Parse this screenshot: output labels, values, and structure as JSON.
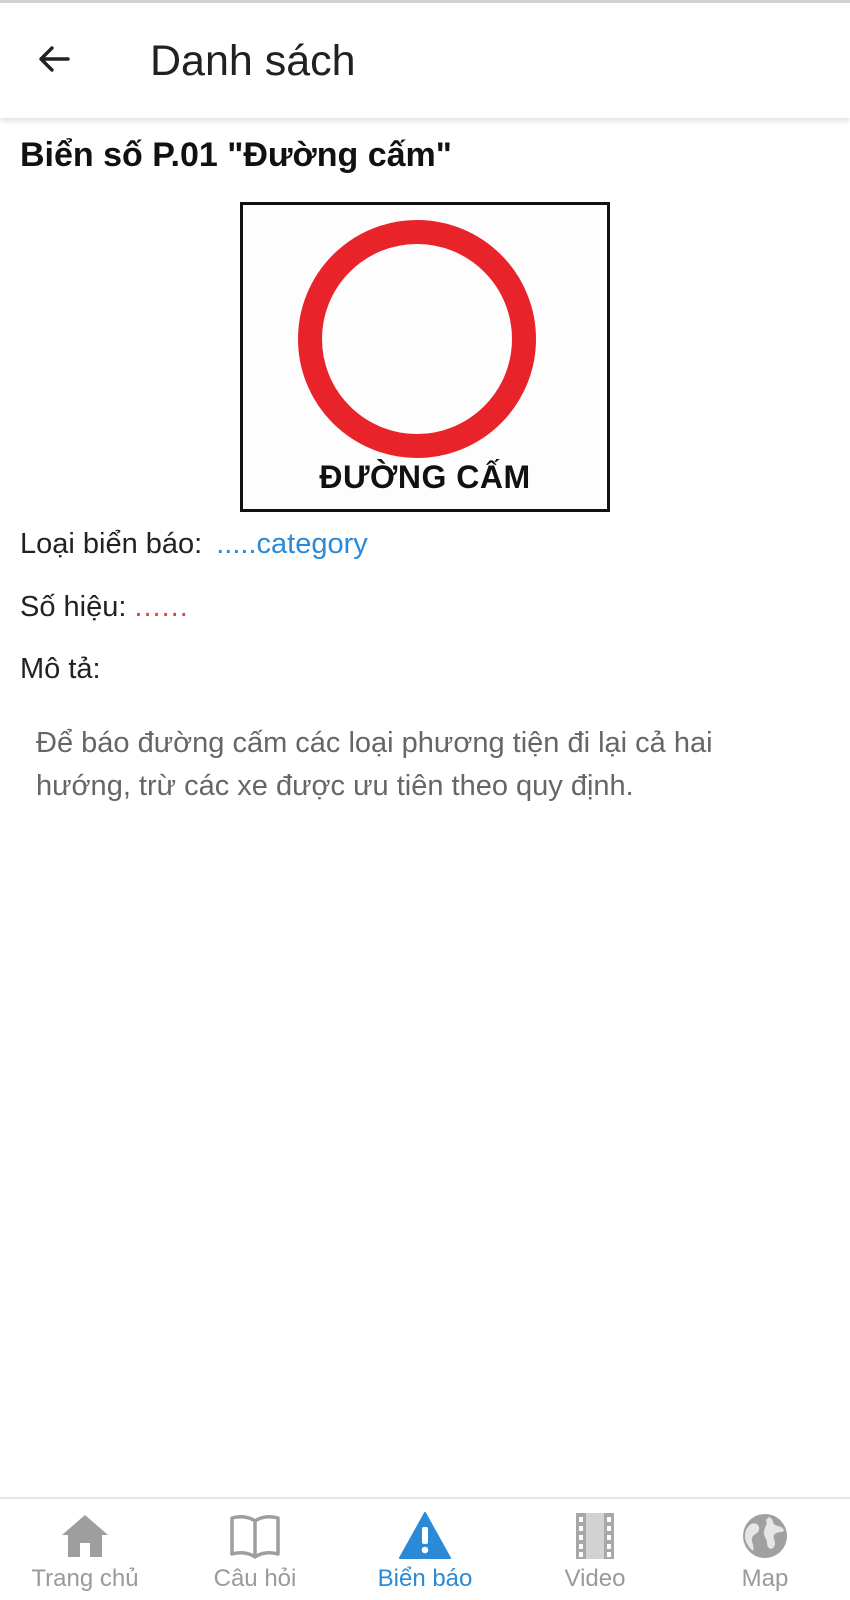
{
  "appbar": {
    "title": "Danh sách",
    "back_icon": "arrow-left-icon"
  },
  "sign": {
    "title": "Biển số P.01 \"Đường cấm\"",
    "image_caption": "ĐƯỜNG CẤM",
    "ring_color": "#e8242a"
  },
  "details": {
    "category_label": "Loại biển báo:",
    "category_value": ".....category",
    "code_label": "Số hiệu:",
    "code_value": "......",
    "description_label": "Mô tả:",
    "description_text": "Để báo đường cấm các loại phương tiện đi lại cả hai hướng, trừ các xe được ưu tiên theo quy định."
  },
  "bottom_nav": {
    "items": [
      {
        "label": "Trang chủ",
        "icon": "home-icon"
      },
      {
        "label": "Câu hỏi",
        "icon": "book-icon"
      },
      {
        "label": "Biển báo",
        "icon": "warning-icon"
      },
      {
        "label": "Video",
        "icon": "film-icon"
      },
      {
        "label": "Map",
        "icon": "globe-icon"
      }
    ],
    "active_index": 2
  },
  "colors": {
    "accent": "#2a8ad8",
    "code_value": "#e0463c",
    "inactive": "#9a9a9a"
  }
}
